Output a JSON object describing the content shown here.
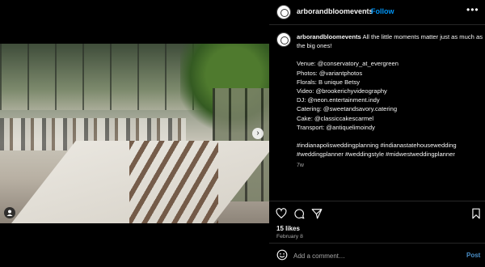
{
  "header": {
    "username": "arborandbloomevents",
    "separator": "•",
    "follow_label": "Follow",
    "more_icon": "more-dots-icon"
  },
  "caption": {
    "username": "arborandbloomevents",
    "lead": "All the little moments matter just as much as the big ones!",
    "credits": [
      "Venue: @conservatory_at_evergreen",
      "Photos: @variantphotos",
      "Florals: B unique Betsy",
      "Video: @brookerichyvideography",
      "DJ: @neon.entertainment.indy",
      "Catering: @sweetandsavory.catering",
      "Cake: @classiccakescarmel",
      "Transport: @antiquelimoindy"
    ],
    "hashtags": "#indianapolisweddingplanning #indianastatehousewedding #weddingplanner #weddingstyle #midwestweddingplanner",
    "time_ago": "7w"
  },
  "stats": {
    "likes": "15 likes",
    "date": "February 8"
  },
  "comment": {
    "placeholder": "Add a comment…",
    "post_label": "Post"
  },
  "media": {
    "next_icon": "chevron-right-icon",
    "tag_icon": "user-tag-icon"
  }
}
